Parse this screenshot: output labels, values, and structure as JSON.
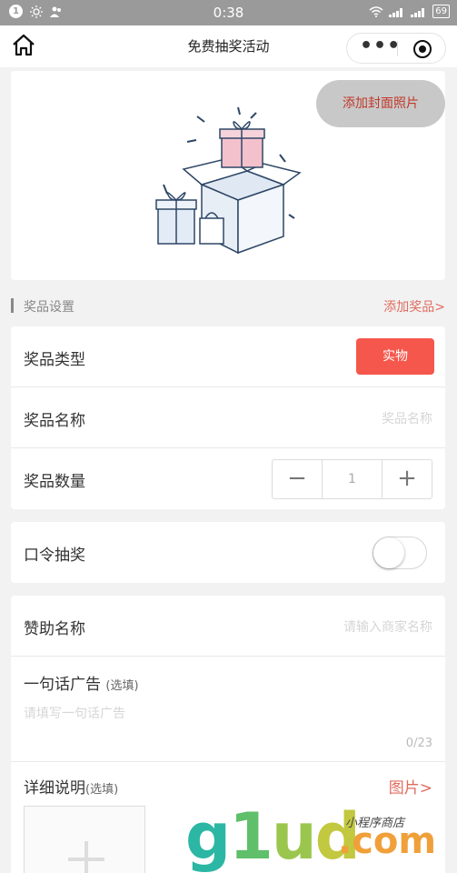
{
  "status_bar": {
    "notification_count": "1",
    "time": "0:38",
    "battery": "69"
  },
  "navbar": {
    "title": "免费抽奖活动",
    "more_glyph": "•••"
  },
  "cover": {
    "add_cover_label": "添加封面照片"
  },
  "prize_section": {
    "header": "奖品设置",
    "add_prize": "添加奖品>",
    "type_label": "奖品类型",
    "type_value": "实物",
    "name_label": "奖品名称",
    "name_placeholder": "奖品名称",
    "quantity_label": "奖品数量",
    "quantity_value": "1",
    "minus": "−",
    "plus": "+"
  },
  "password_draw": {
    "label": "口令抽奖",
    "enabled": false
  },
  "sponsor": {
    "name_label": "赞助名称",
    "name_placeholder": "请输入商家名称",
    "ad_label": "一句话广告",
    "ad_optional": "(选填)",
    "ad_placeholder": "请填写一句话广告",
    "ad_count": "0/23",
    "detail_label": "详细说明",
    "detail_optional": "(选填)",
    "picture_link": "图片>"
  },
  "watermark": {
    "brand_1": "g",
    "brand_2": "1",
    "brand_3": "u",
    "brand_4": "d",
    "domain": ".com",
    "tagline": "小程序商店"
  },
  "colors": {
    "accent_red": "#f5574c",
    "link_red": "#e06c60",
    "status_bar": "#9a9a9a"
  }
}
